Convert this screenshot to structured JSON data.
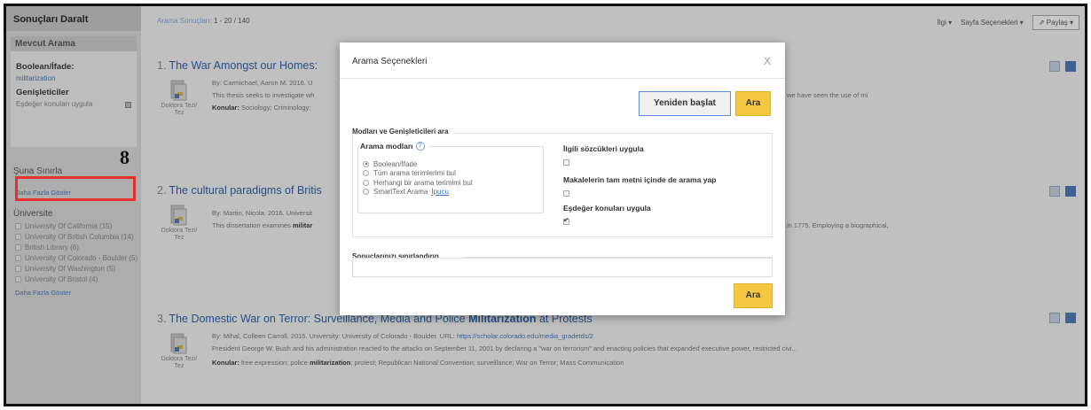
{
  "sidebar": {
    "header": "Sonuçları Daralt",
    "current_search": "Mevcut Arama",
    "boolean_label": "Boolean/İfade:",
    "boolean_value": "militarization",
    "expanders_label": "Genişleticiler",
    "expander_item": "Eşdeğer konuları uygula",
    "limit_to": "Şuna Sınırla",
    "show_more_1": "Daha Fazla Göster",
    "university_label": "Üniversite",
    "universities": [
      "University Of California (15)",
      "University Of British Columbia (14)",
      "British Library (6)",
      "University Of Colorado - Boulder (5)",
      "University Of Washington (5)",
      "University Of Bristol (4)"
    ],
    "show_more_2": "Daha Fazla Göster"
  },
  "annotation": {
    "step": "8"
  },
  "main": {
    "results_label": "Arama Sonuçları:",
    "results_range": "1 - 20 / 140",
    "toolbar": {
      "relevance": "İlgi ▾",
      "page_options": "Sayfa Seçenekleri ▾",
      "share": "Paylaş ▾"
    }
  },
  "results": [
    {
      "num": "1.",
      "title": "The War Amongst our Homes:",
      "meta": "By: Carmichael, Aaron M. 2016. U",
      "abstract": "This thesis seeks to investigate wh",
      "abstract_end": "we have seen the use of mi",
      "subjects_label": "Konular:",
      "subjects": "Sociology; Criminology;",
      "doc_type": "Doktora Tezi/ Tez"
    },
    {
      "num": "2.",
      "title": "The cultural paradigms of Britis",
      "meta": "By: Martin, Nicola. 2016. Universit",
      "abstract": "This dissertation examines",
      "abstract_bold": "militar",
      "abstract_end": "in 1775. Employing a biographical,",
      "doc_type": "Doktora Tezi/ Tez"
    },
    {
      "num": "3.",
      "title_pre": "The Domestic War on Terror: Surveillance, Media and Police",
      "title_bold": "Militarization",
      "title_post": "at Protests",
      "meta_pre": "By: Mihal, Colleen Carroll. 2015. University: University of Colorado - Boulder. URL:",
      "meta_url": "https://scholar.colorado.edu/media_gradetds/2",
      "abstract": "President George W. Bush and his administration reacted to the attacks on September 11, 2001 by declaring a \"war on terrorism\" and enacting policies that expanded executive power, restricted civi...",
      "subjects_label": "Konular:",
      "subjects_pre": "free expression; police",
      "subjects_bold": "militarization",
      "subjects_post": "; protest; Republican National Convention; surveillance; War on Terror; Mass Communication",
      "doc_type": "Doktora Tezi/ Tez"
    }
  ],
  "modal": {
    "title": "Arama Seçenekleri",
    "close": "X",
    "reset": "Yeniden başlat",
    "search": "Ara",
    "modes_expanders": "Modları ve Genişleticileri ara",
    "search_modes": "Arama modları",
    "help": "?",
    "modes": [
      "Boolean/İfade",
      "Tüm arama terimlerimi bul",
      "Herhangi bir arama terimimi bul",
      "SmartText Arama"
    ],
    "smarttext_link": "İpucu",
    "opt1": "İlgili sözcükleri uygula",
    "opt2": "Makalelerin tam metni içinde de arama yap",
    "opt3": "Eşdeğer konuları uygula",
    "limit": "Sonuçlarınızı sınırlandırın",
    "search2": "Ara"
  }
}
